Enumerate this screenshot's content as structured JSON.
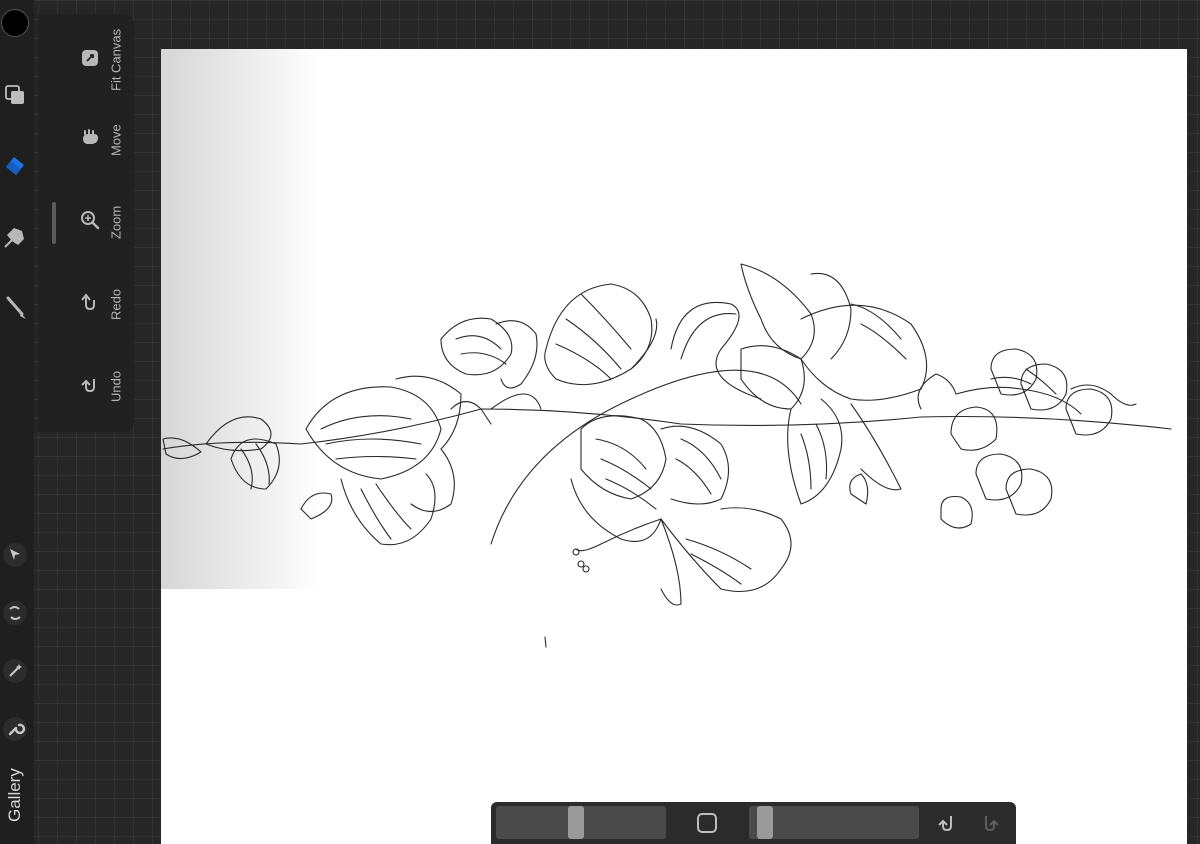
{
  "colors": {
    "brush_color": "#000000",
    "active_tool": "#1a73e8"
  },
  "left_toolbar": {
    "tools": [
      {
        "name": "layers",
        "icon": "layers-icon"
      },
      {
        "name": "eraser",
        "icon": "eraser-icon",
        "active": true
      },
      {
        "name": "smudge",
        "icon": "smudge-icon"
      },
      {
        "name": "brush",
        "icon": "brush-icon"
      },
      {
        "name": "selection",
        "icon": "arrow-cursor-icon"
      },
      {
        "name": "transform",
        "icon": "transform-icon"
      },
      {
        "name": "adjustments",
        "icon": "magic-wand-icon"
      },
      {
        "name": "actions",
        "icon": "wrench-icon"
      }
    ],
    "gallery_label": "Gallery"
  },
  "gesture_panel": {
    "items": [
      {
        "label": "Fit Canvas",
        "icon": "fit-canvas-icon"
      },
      {
        "label": "Move",
        "icon": "hand-icon"
      },
      {
        "label": "Zoom",
        "icon": "zoom-icon"
      },
      {
        "label": "Redo",
        "icon": "redo-icon"
      },
      {
        "label": "Undo",
        "icon": "undo-icon"
      }
    ]
  },
  "bottom_bar": {
    "brush_size_value": 0.47,
    "opacity_value": 0.05,
    "undo_icon": "undo-icon",
    "redo_icon": "redo-icon"
  }
}
